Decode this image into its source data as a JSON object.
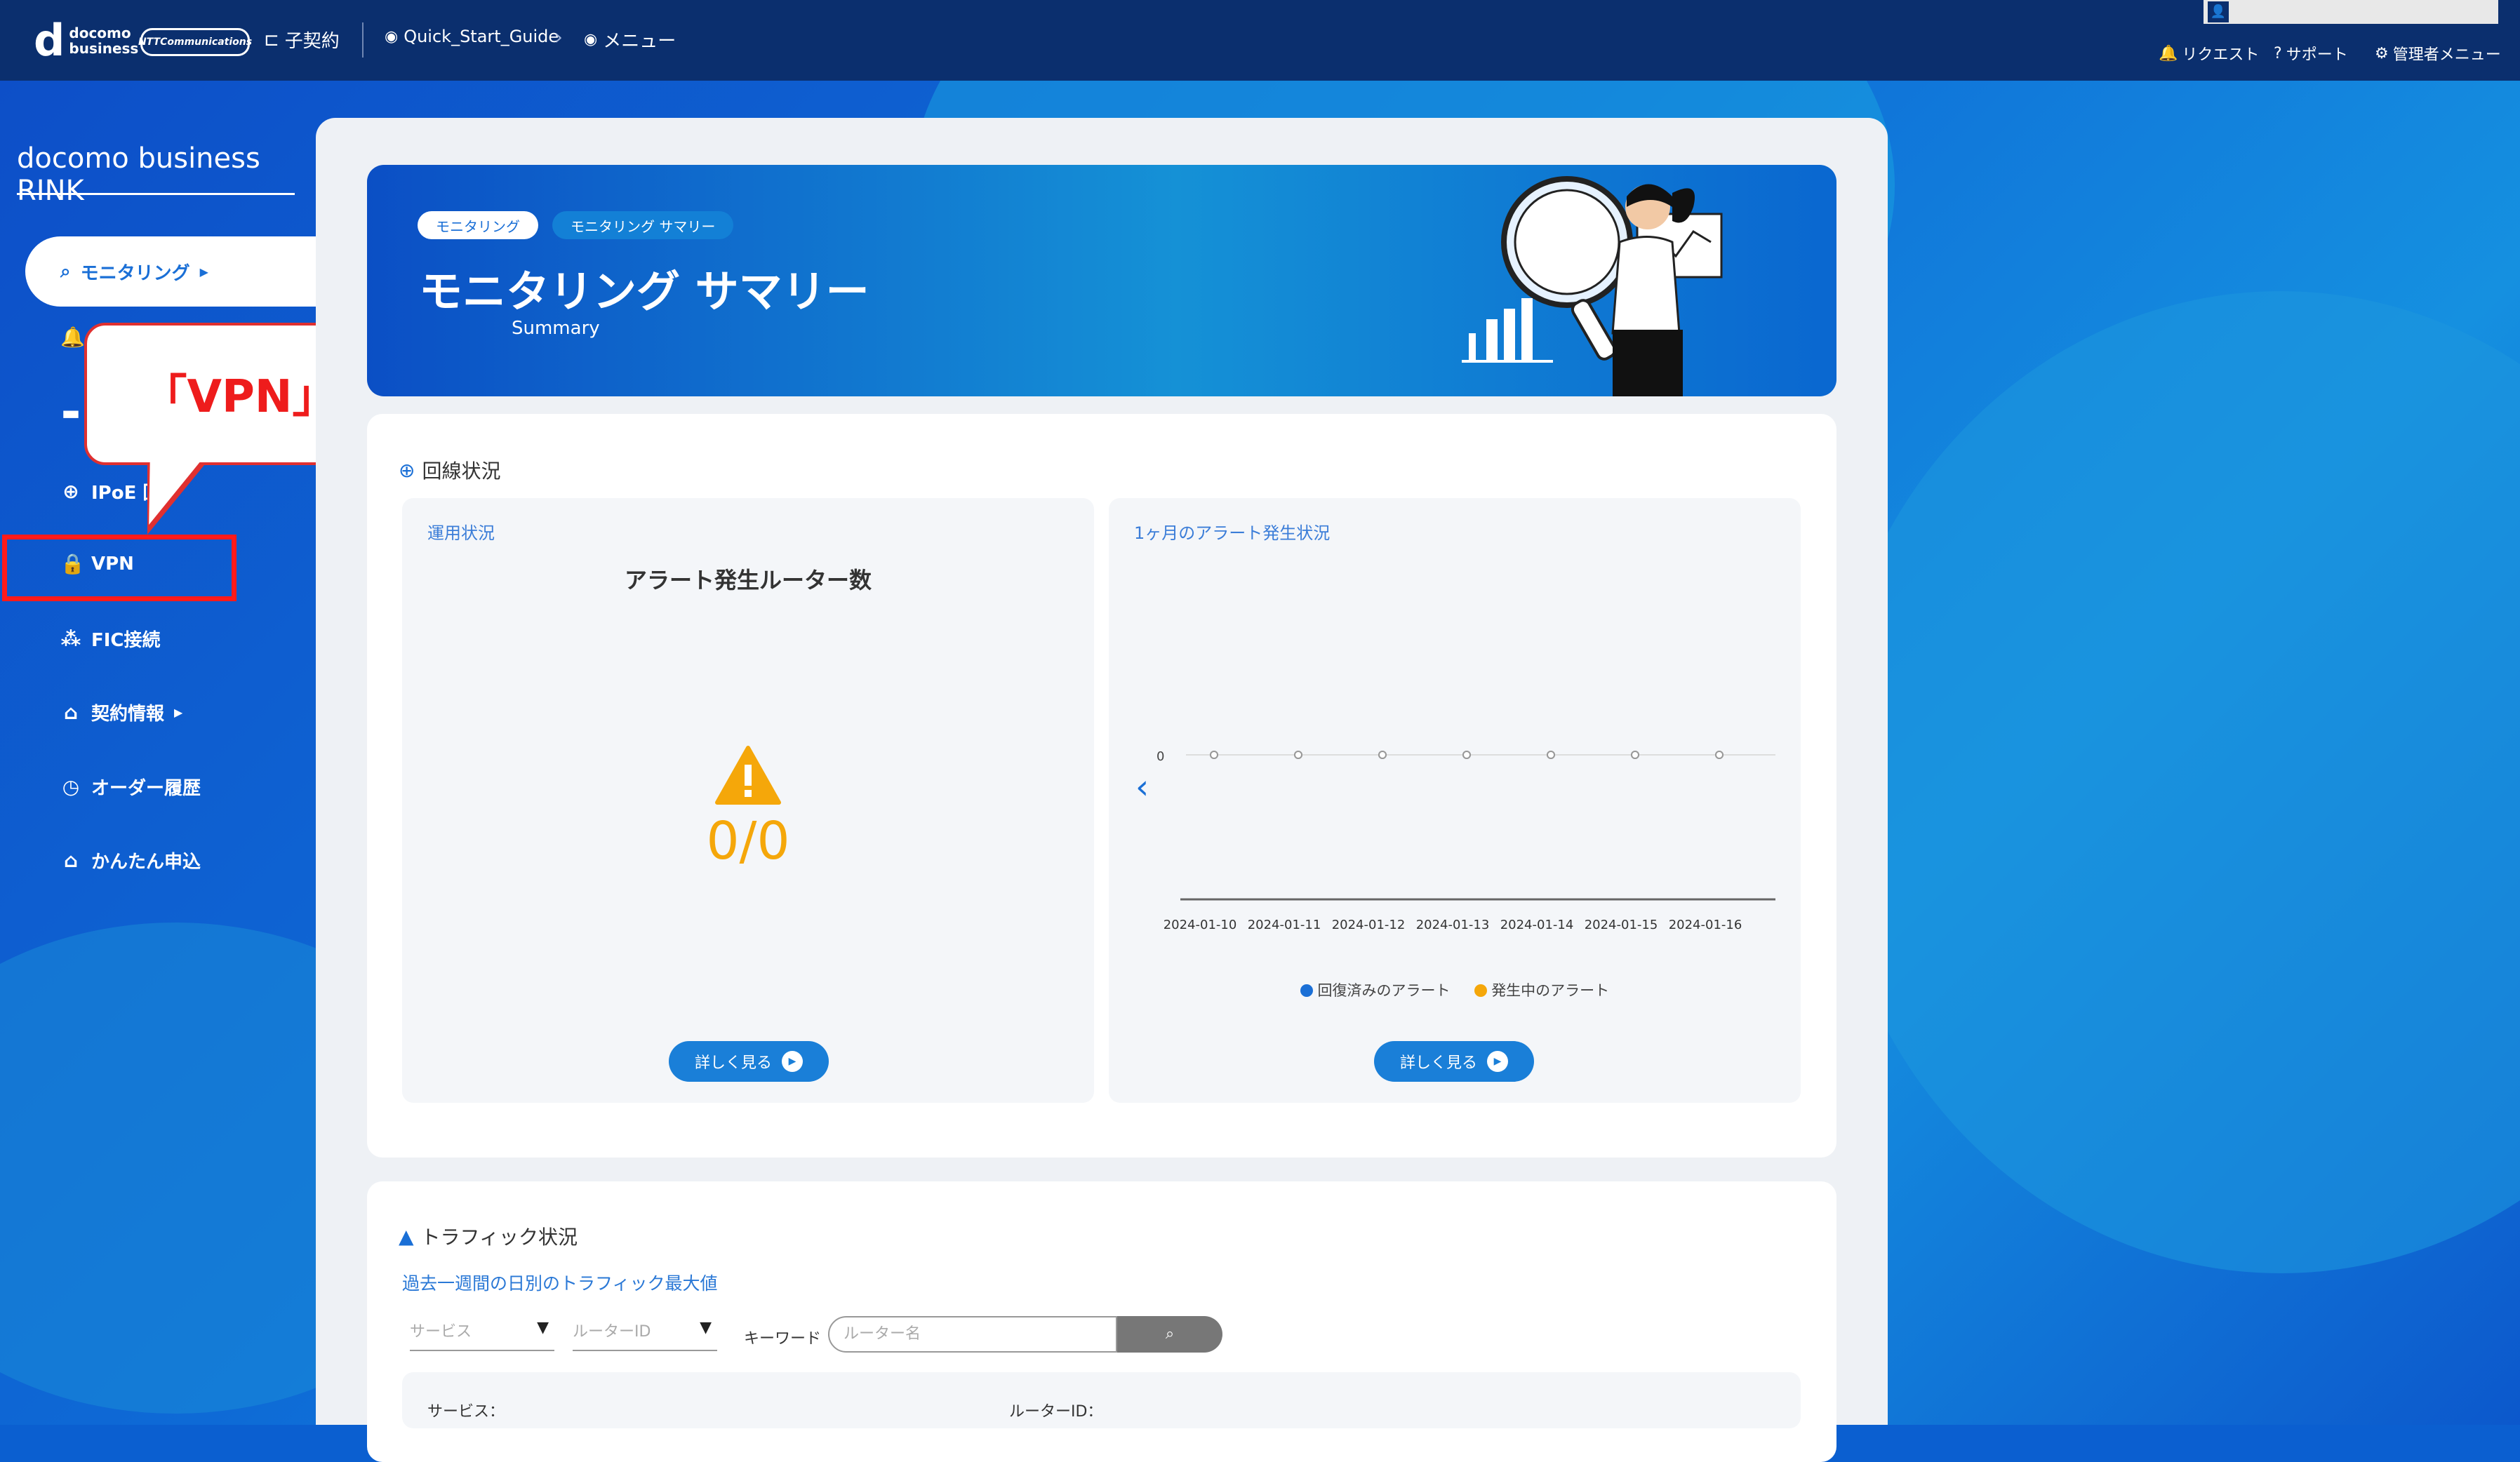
{
  "topbar": {
    "logo_mark": "d",
    "logo_line1": "docomo",
    "logo_line2": "business",
    "ntt": "NTTCommunications",
    "contract": "子契約",
    "guide": "Quick_Start_Guide",
    "menu": "メニュー",
    "request": "リクエスト",
    "support": "サポート",
    "admin_menu": "管理者メニュー"
  },
  "sidebar": {
    "brand": "docomo business RINK",
    "items": [
      {
        "label": "モニタリング",
        "icon": "search-icon"
      },
      {
        "label": "IPoE 回",
        "icon": "globe-icon"
      },
      {
        "label": "VPN",
        "icon": "lock-icon"
      },
      {
        "label": "FIC接続",
        "icon": "network-icon"
      },
      {
        "label": "契約情報",
        "icon": "home-icon"
      },
      {
        "label": "オーダー履歴",
        "icon": "clock-icon"
      },
      {
        "label": "かんたん申込",
        "icon": "home-icon"
      }
    ]
  },
  "callout": {
    "text": "「VPN」を選択"
  },
  "hero": {
    "crumb1": "モニタリング",
    "crumb2": "モニタリング サマリー",
    "title": "モニタリング サマリー",
    "subtitle": "Summary"
  },
  "status": {
    "title": "回線状況",
    "left_label": "運用状況",
    "left_heading": "アラート発生ルーター数",
    "count": "0/0",
    "right_label": "1ヶ月のアラート発生状況",
    "details_button": "詳しく見る"
  },
  "chart_data": {
    "type": "line",
    "title": "",
    "x": [
      "2024-01-10",
      "2024-01-11",
      "2024-01-12",
      "2024-01-13",
      "2024-01-14",
      "2024-01-15",
      "2024-01-16"
    ],
    "series": [
      {
        "name": "回復済みのアラート",
        "values": [
          0,
          0,
          0,
          0,
          0,
          0,
          0
        ],
        "color": "#1a6fd6"
      },
      {
        "name": "発生中のアラート",
        "values": [
          0,
          0,
          0,
          0,
          0,
          0,
          0
        ],
        "color": "#f5a70a"
      }
    ],
    "y_tick": "0",
    "legend_position": "bottom"
  },
  "traffic": {
    "title": "トラフィック状況",
    "subtitle": "過去一週間の日別のトラフィック最大値",
    "service_placeholder": "サービス",
    "router_placeholder": "ルーターID",
    "keyword_label": "キーワード",
    "keyword_placeholder": "ルーター名",
    "row_service_label": "サービス：",
    "row_router_label": "ルーターID："
  }
}
